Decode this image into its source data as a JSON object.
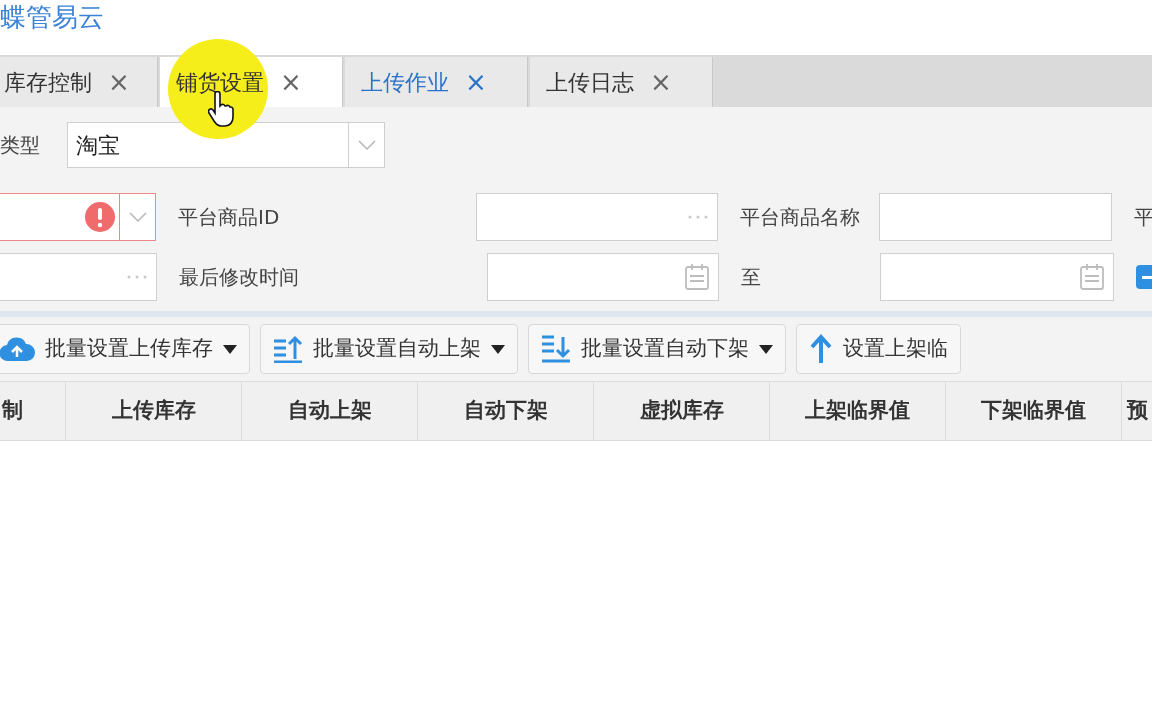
{
  "logo": "蝶管易云",
  "tabs": [
    {
      "label": "库存控制",
      "close": "×",
      "selected": false,
      "hovered": false
    },
    {
      "label": "铺货设置",
      "close": "×",
      "selected": true,
      "hovered": false
    },
    {
      "label": "上传作业",
      "close": "×",
      "selected": false,
      "hovered": true
    },
    {
      "label": "上传日志",
      "close": "×",
      "selected": false,
      "hovered": false
    }
  ],
  "type_filter": {
    "label": "类型",
    "value": "淘宝"
  },
  "filter_rows": [
    [
      {
        "kind": "select",
        "error": true
      },
      {
        "kind": "label",
        "text": "平台商品ID"
      },
      {
        "kind": "lookup",
        "error": false
      },
      {
        "kind": "label",
        "text": "平台商品名称"
      },
      {
        "kind": "text",
        "error": false
      },
      {
        "kind": "label",
        "text": "平"
      }
    ],
    [
      {
        "kind": "lookup",
        "error": false
      },
      {
        "kind": "label",
        "text": "最后修改时间"
      },
      {
        "kind": "date",
        "error": false
      },
      {
        "kind": "label",
        "text": "至"
      },
      {
        "kind": "date",
        "error": false
      },
      {
        "kind": "toggle"
      }
    ]
  ],
  "toolbar": [
    {
      "label": "批量设置上传库存",
      "kind": "cloud",
      "dropdown": true
    },
    {
      "label": "批量设置自动上架",
      "kind": "sortup",
      "dropdown": true
    },
    {
      "label": "批量设置自动下架",
      "kind": "sortdown",
      "dropdown": true
    },
    {
      "label": "设置上架临",
      "kind": "arrowup",
      "dropdown": false
    }
  ],
  "table": {
    "columns": [
      "制",
      "上传库存",
      "自动上架",
      "自动下架",
      "虚拟库存",
      "上架临界值",
      "下架临界值",
      "预"
    ]
  }
}
